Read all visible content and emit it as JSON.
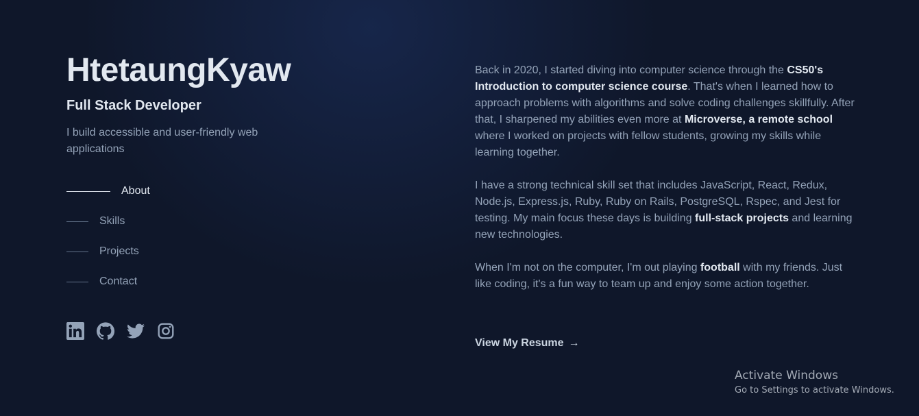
{
  "header": {
    "name": "HtetaungKyaw",
    "role": "Full Stack Developer",
    "tagline": "I build accessible and user-friendly web applications"
  },
  "nav": {
    "items": [
      {
        "label": "About",
        "active": true
      },
      {
        "label": "Skills",
        "active": false
      },
      {
        "label": "Projects",
        "active": false
      },
      {
        "label": "Contact",
        "active": false
      }
    ]
  },
  "social": {
    "icons": [
      "linkedin-icon",
      "github-icon",
      "twitter-icon",
      "instagram-icon"
    ]
  },
  "about": {
    "p1": {
      "t1": "Back in 2020, I started diving into computer science through the ",
      "b1": "CS50's Introduction to computer science course",
      "t2": ". That's when I learned how to approach problems with algorithms and solve coding challenges skillfully. After that, I sharpened my abilities even more at ",
      "b2": "Microverse, a remote school",
      "t3": " where I worked on projects with fellow students, growing my skills while learning together."
    },
    "p2": {
      "t1": "I have a strong technical skill set that includes JavaScript, React, Redux, Node.js, Express.js, Ruby, Ruby on Rails, PostgreSQL, Rspec, and Jest for testing. My main focus these days is building ",
      "b1": "full-stack projects",
      "t2": " and learning new technologies."
    },
    "p3": {
      "t1": "When I'm not on the computer, I'm out playing ",
      "b1": "football",
      "t2": " with my friends. Just like coding, it's a fun way to team up and enjoy some action together."
    }
  },
  "resume": {
    "label": "View My Resume",
    "arrow": "→"
  },
  "watermark": {
    "title": "Activate Windows",
    "subtitle": "Go to Settings to activate Windows."
  },
  "colors": {
    "background": "#0f172a",
    "heading": "#e2e8f0",
    "body_text": "#94a3b8"
  }
}
